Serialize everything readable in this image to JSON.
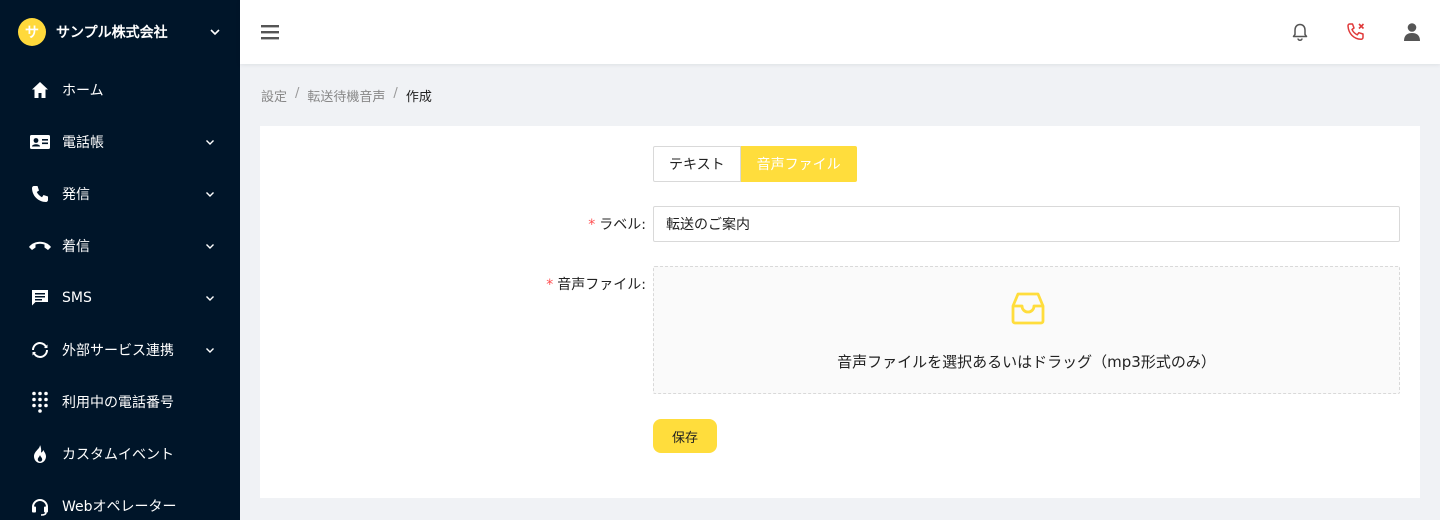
{
  "sidebar": {
    "brand_initial": "サ",
    "brand_name": "サンプル株式会社",
    "items": [
      {
        "label": "ホーム"
      },
      {
        "label": "電話帳"
      },
      {
        "label": "発信"
      },
      {
        "label": "着信"
      },
      {
        "label": "SMS"
      },
      {
        "label": "外部サービス連携"
      },
      {
        "label": "利用中の電話番号"
      },
      {
        "label": "カスタムイベント"
      },
      {
        "label": "Webオペレーター"
      }
    ]
  },
  "breadcrumb": {
    "items": [
      "設定",
      "転送待機音声",
      "作成"
    ],
    "separator": "/"
  },
  "form": {
    "type_tabs": [
      "テキスト",
      "音声ファイル"
    ],
    "selected_tab": "音声ファイル",
    "label_field_label": "ラベル:",
    "label_value": "転送のご案内",
    "file_field_label": "音声ファイル:",
    "upload_hint": "音声ファイルを選択あるいはドラッグ（mp3形式のみ）",
    "save_label": "保存",
    "required_mark": "*"
  },
  "colors": {
    "accent": "#ffdd3c",
    "sidebar_bg": "#001529",
    "required": "#ff4d4f",
    "call_icon": "#e03a3a"
  }
}
